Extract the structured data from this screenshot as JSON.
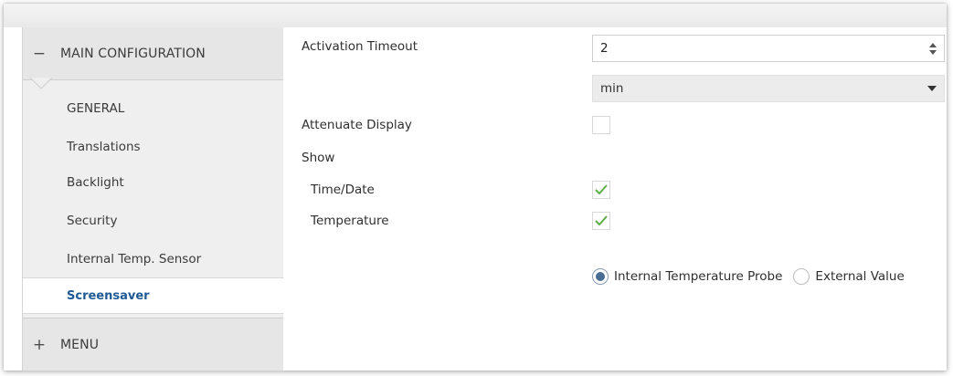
{
  "sidebar": {
    "main_section": {
      "toggle": "−",
      "label": "MAIN CONFIGURATION"
    },
    "items": [
      {
        "label": "GENERAL"
      },
      {
        "label": "Translations"
      },
      {
        "label": "Backlight"
      },
      {
        "label": "Security"
      },
      {
        "label": "Internal Temp. Sensor"
      },
      {
        "label": "Screensaver",
        "active": true
      }
    ],
    "menu_section": {
      "toggle": "+",
      "label": "MENU"
    }
  },
  "form": {
    "activation_timeout": {
      "label": "Activation Timeout",
      "value": "2",
      "unit": "min"
    },
    "attenuate_display": {
      "label": "Attenuate Display",
      "checked": false
    },
    "show": {
      "label": "Show"
    },
    "time_date": {
      "label": "Time/Date",
      "checked": true
    },
    "temperature": {
      "label": "Temperature",
      "checked": true
    },
    "temperature_source": {
      "options": [
        "Internal Temperature Probe",
        "External Value"
      ],
      "selected": "Internal Temperature Probe"
    }
  },
  "colors": {
    "accent": "#1e5a96",
    "check": "#5fae48",
    "sidebar_bg": "#efefef"
  }
}
